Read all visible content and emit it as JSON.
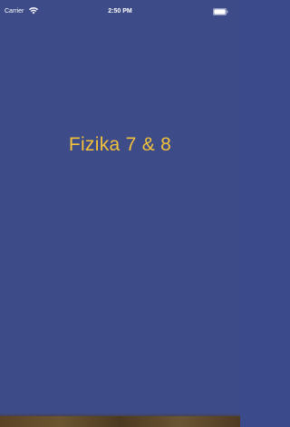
{
  "status_bar": {
    "carrier": "Carrier",
    "time": "2:50 PM",
    "battery_level": 1.0,
    "icons": [
      "wifi-icon",
      "battery-icon"
    ]
  },
  "splash": {
    "title": "Fizika 7 & 8"
  },
  "colors": {
    "background": "#3d4b89",
    "title": "#f3c13a",
    "status_text": "#ffffff"
  }
}
